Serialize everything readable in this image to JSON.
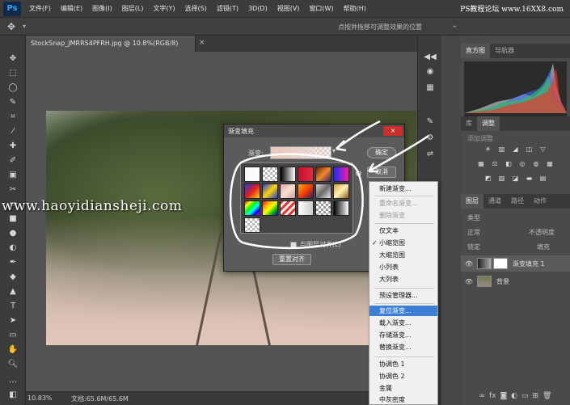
{
  "app": {
    "logo": "Ps",
    "menu": [
      "文件(F)",
      "编辑(E)",
      "图像(I)",
      "图层(L)",
      "文字(Y)",
      "选择(S)",
      "滤镜(T)",
      "3D(D)",
      "视图(V)",
      "窗口(W)",
      "帮助(H)"
    ],
    "site_badge": "PS教程论坛 www.16XX8.com"
  },
  "options_bar": {
    "hint": "点按并拖移可调整效果的位置"
  },
  "document": {
    "tab_title": "StockSnap_JMRRS4PFRH.jpg @ 10.8%(RGB/8)",
    "tab_close": "×",
    "zoom": "10.83%",
    "doc_size": "文档:65.6M/65.6M"
  },
  "watermark": "www.haoyidiansheji.com",
  "panels": {
    "top_tabs": [
      "直方图",
      "导航器"
    ],
    "mid_tabs": [
      "库",
      "调整"
    ],
    "adj_label": "添加调整",
    "layer_tabs": [
      "图层",
      "通道",
      "路径",
      "动作"
    ],
    "layer_kind": "类型",
    "blend_mode": "正常",
    "opacity_label": "不透明度",
    "lock_label": "锁定",
    "fill_label": "填充",
    "layers": [
      {
        "name": "渐变填充 1",
        "selected": true
      },
      {
        "name": "背景",
        "selected": false
      }
    ]
  },
  "dialog": {
    "title": "渐变填充",
    "close": "×",
    "gradient_label": "渐变:",
    "ok": "确定",
    "cancel": "取消",
    "align_label": "与图层对齐(L)",
    "reset_align": "重置对齐"
  },
  "context_menu": {
    "items": [
      {
        "label": "新建渐变...",
        "disabled": false
      },
      {
        "label": "重命名渐变...",
        "disabled": true
      },
      {
        "label": "删除渐变",
        "disabled": true
      },
      {
        "label": "仅文本",
        "disabled": false
      },
      {
        "label": "小缩览图",
        "disabled": false,
        "checked": true
      },
      {
        "label": "大缩览图",
        "disabled": false
      },
      {
        "label": "小列表",
        "disabled": false
      },
      {
        "label": "大列表",
        "disabled": false
      },
      {
        "label": "预设管理器...",
        "disabled": false
      },
      {
        "label": "复位渐变...",
        "disabled": false,
        "highlight": true
      },
      {
        "label": "载入渐变...",
        "disabled": false
      },
      {
        "label": "存储渐变...",
        "disabled": false
      },
      {
        "label": "替换渐变...",
        "disabled": false
      },
      {
        "label": "协调色 1",
        "disabled": false
      },
      {
        "label": "协调色 2",
        "disabled": false
      },
      {
        "label": "金属",
        "disabled": false
      },
      {
        "label": "中灰密度",
        "disabled": false
      }
    ],
    "check_mark": "✓"
  },
  "colors": {
    "highlight": "#3b80d6",
    "close_red": "#c8312a",
    "annotation": "#ffffff"
  }
}
